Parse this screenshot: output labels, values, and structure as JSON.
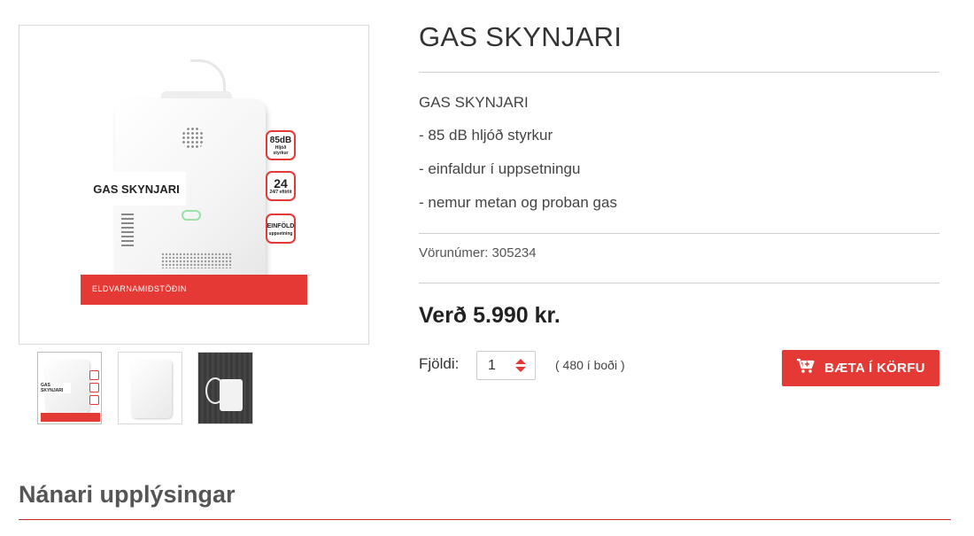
{
  "product": {
    "title": "GAS SKYNJARI",
    "image_label": "GAS SKYNJARI",
    "image_brand": "ELDVARNAMIÐSTÖÐIN",
    "image_badges": [
      {
        "big": "85dB",
        "small": "Hljóð styrkur"
      },
      {
        "big": "24",
        "small": "24/7 eftirlit"
      },
      {
        "big": "EINFÖLD",
        "small": "uppsetning"
      }
    ],
    "description": [
      "GAS SKYNJARI",
      "- 85 dB hljóð styrkur",
      "- einfaldur í uppsetningu",
      "- nemur metan og proban gas"
    ],
    "sku": "Vörunúmer: 305234",
    "price": "Verð 5.990 kr.",
    "quantity_label": "Fjöldi:",
    "quantity_value": "1",
    "stock": "( 480 í boði )",
    "add_to_cart": "BÆTA Í KÖRFU"
  },
  "details": {
    "title": "Nánari upplýsingar"
  },
  "colors": {
    "accent": "#e53935",
    "text": "#333333",
    "divider": "#cfcfcf"
  },
  "icons": [
    "cart-plus-icon",
    "spinner-up-icon",
    "spinner-down-icon"
  ]
}
